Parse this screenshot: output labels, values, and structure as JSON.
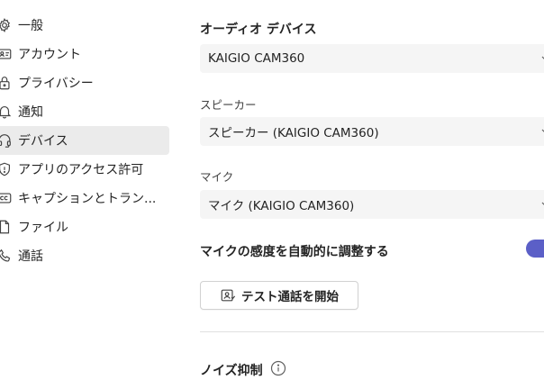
{
  "sidebar": {
    "items": [
      {
        "label": "一般",
        "icon": "gear-icon"
      },
      {
        "label": "アカウント",
        "icon": "id-card-icon"
      },
      {
        "label": "プライバシー",
        "icon": "lock-icon"
      },
      {
        "label": "通知",
        "icon": "bell-icon"
      },
      {
        "label": "デバイス",
        "icon": "headset-icon",
        "active": true
      },
      {
        "label": "アプリのアクセス許可",
        "icon": "shield-icon"
      },
      {
        "label": "キャプションとトラン...",
        "icon": "closed-caption-icon"
      },
      {
        "label": "ファイル",
        "icon": "file-icon"
      },
      {
        "label": "通話",
        "icon": "phone-icon"
      }
    ]
  },
  "main": {
    "audio_device_title": "オーディオ デバイス",
    "audio_device_value": "KAIGIO CAM360",
    "speaker_label": "スピーカー",
    "speaker_value": "スピーカー (KAIGIO CAM360)",
    "mic_label": "マイク",
    "mic_value": "マイク (KAIGIO CAM360)",
    "auto_adjust_label": "マイクの感度を自動的に調整する",
    "auto_adjust_enabled": true,
    "test_call_label": "テスト通話を開始",
    "noise_suppression_title": "ノイズ抑制"
  },
  "colors": {
    "accent": "#5b5fc7",
    "active_nav_bg": "#ebebeb",
    "dropdown_bg": "#f5f5f5"
  }
}
